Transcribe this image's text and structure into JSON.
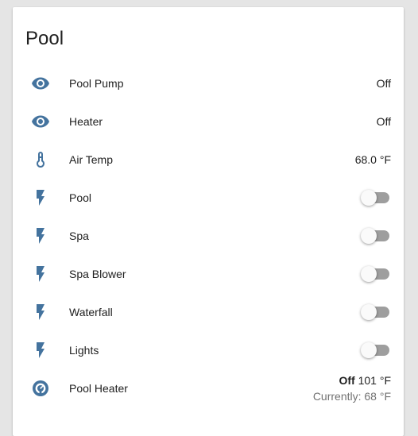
{
  "card": {
    "title": "Pool",
    "accent_color": "#44739e"
  },
  "entities": [
    {
      "name": "Pool Pump",
      "icon": "eye-icon",
      "state": "Off",
      "type": "sensor"
    },
    {
      "name": "Heater",
      "icon": "eye-icon",
      "state": "Off",
      "type": "sensor"
    },
    {
      "name": "Air Temp",
      "icon": "thermometer-icon",
      "state": "68.0 °F",
      "type": "sensor"
    },
    {
      "name": "Pool",
      "icon": "flash-icon",
      "state": "off",
      "type": "switch"
    },
    {
      "name": "Spa",
      "icon": "flash-icon",
      "state": "off",
      "type": "switch"
    },
    {
      "name": "Spa Blower",
      "icon": "flash-icon",
      "state": "off",
      "type": "switch"
    },
    {
      "name": "Waterfall",
      "icon": "flash-icon",
      "state": "off",
      "type": "switch"
    },
    {
      "name": "Lights",
      "icon": "flash-icon",
      "state": "off",
      "type": "switch"
    },
    {
      "name": "Pool Heater",
      "icon": "thermostat-icon",
      "type": "climate",
      "mode": "Off",
      "target": "101 °F",
      "current": "Currently: 68 °F"
    }
  ]
}
